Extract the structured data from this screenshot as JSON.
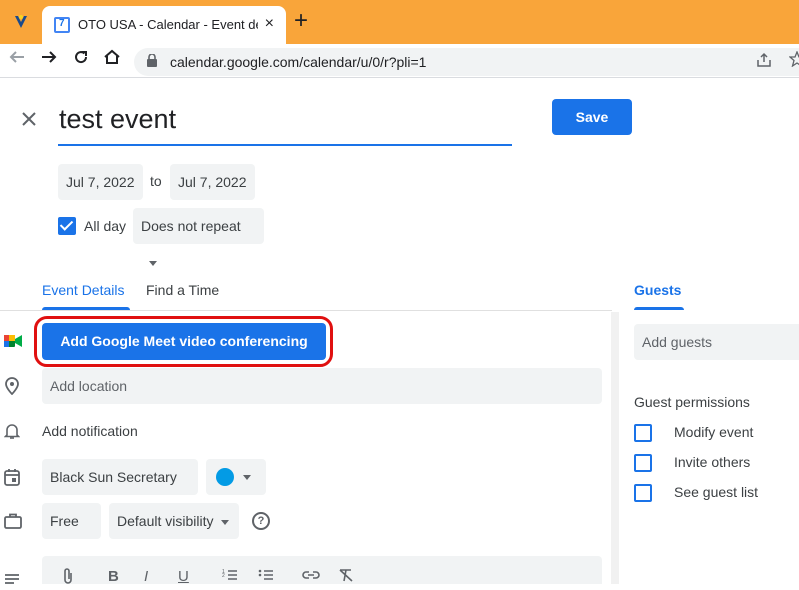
{
  "browser": {
    "tab_title": "OTO USA - Calendar - Event deta",
    "tab_close": "×",
    "new_tab": "+",
    "url": "calendar.google.com/calendar/u/0/r?pli=1"
  },
  "event": {
    "title": "test event",
    "save_label": "Save",
    "start_date": "Jul 7, 2022",
    "to_label": "to",
    "end_date": "Jul 7, 2022",
    "all_day_label": "All day",
    "all_day_checked": true,
    "repeat_value": "Does not repeat"
  },
  "tabs": [
    {
      "label": "Event Details",
      "active": true
    },
    {
      "label": "Find a Time",
      "active": false
    }
  ],
  "details": {
    "meet_button": "Add Google Meet video conferencing",
    "location_placeholder": "Add location",
    "notification_label": "Add notification",
    "calendar_value": "Black Sun Secretary",
    "event_color": "#039be5",
    "availability_value": "Free",
    "visibility_value": "Default visibility",
    "help_glyph": "?"
  },
  "guests": {
    "header": "Guests",
    "input_placeholder": "Add guests",
    "permissions_title": "Guest permissions",
    "permissions": [
      {
        "label": "Modify event",
        "checked": false
      },
      {
        "label": "Invite others",
        "checked": false
      },
      {
        "label": "See guest list",
        "checked": false
      }
    ]
  },
  "colors": {
    "accent": "#1a73e8",
    "highlight": "#e01010",
    "tabbar": "#f9a53a"
  }
}
